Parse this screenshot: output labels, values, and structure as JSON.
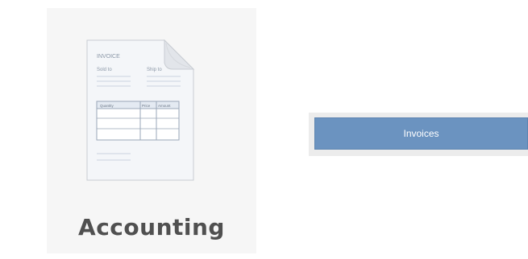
{
  "tile": {
    "label": "Accounting",
    "icon": "invoice-document-icon",
    "icon_text": {
      "title": "INVOICE",
      "sold_to": "Sold to",
      "ship_to": "Ship to",
      "col_quantity": "Quantity",
      "col_price": "Price",
      "col_amount": "Amount"
    }
  },
  "invoices_button": {
    "label": "Invoices"
  },
  "colors": {
    "button_bg": "#6b93c0",
    "tile_bg": "#f6f6f6",
    "label_text": "#505050"
  }
}
